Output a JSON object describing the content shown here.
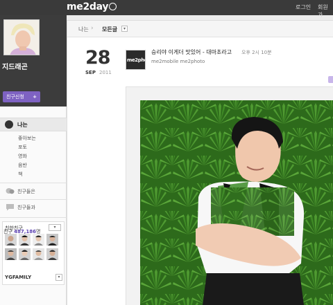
{
  "header": {
    "logo": "me2day",
    "login": "로그인",
    "join": "회원가"
  },
  "sidebar": {
    "profile_name": "지드래곤",
    "friend_request_label": "친구신청",
    "friend_request_plus": "+",
    "nav_me": "나는",
    "sub_items": [
      "좋아보는",
      "포토",
      "영화",
      "음반",
      "책"
    ],
    "friends_like": "친구들은",
    "friends_with": "친구들과",
    "friend_count_prefix": "친구",
    "friend_count": "487,186",
    "friend_count_suffix": "명",
    "close_friends_label": "친한친구",
    "group_name": "YGFAMILY"
  },
  "breadcrumb": {
    "me": "나는",
    "all": "모든글"
  },
  "post": {
    "day": "28",
    "month": "SEP",
    "year": "2011",
    "avatar_text": "me2photo",
    "title": "승리야 이게더 맛있어 - 대마초라고",
    "time": "오후 2시 10분",
    "via": "me2mobile me2photo"
  },
  "colors": {
    "topbar": "#3a3a3a",
    "sidebar_dark": "#3c3c3c",
    "accent_purple": "#7e62c2",
    "leaf_green": "#3c8b27"
  }
}
